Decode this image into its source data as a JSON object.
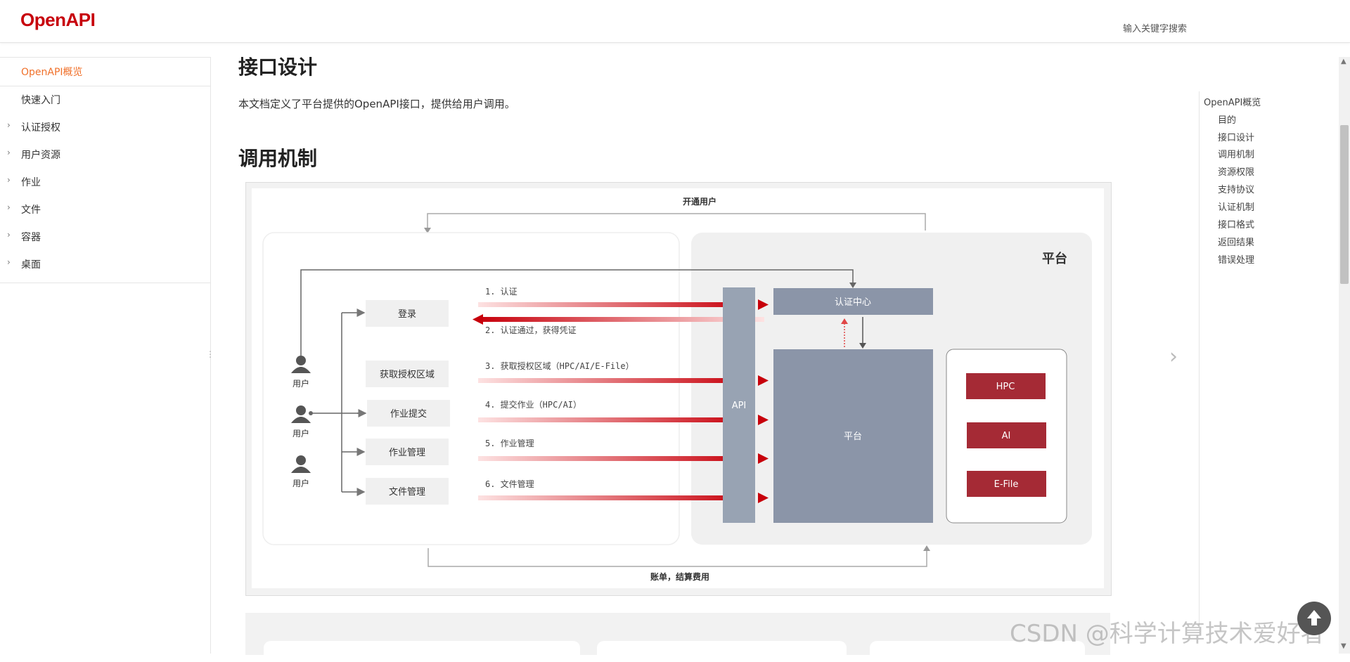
{
  "header": {
    "logo": "OpenAPI",
    "search_placeholder": "输入关键字搜索"
  },
  "sidebar": {
    "items": [
      {
        "label": "OpenAPI概览",
        "active": true,
        "expandable": false
      },
      {
        "label": "快速入门",
        "active": false,
        "expandable": false
      },
      {
        "label": "认证授权",
        "active": false,
        "expandable": true
      },
      {
        "label": "用户资源",
        "active": false,
        "expandable": true
      },
      {
        "label": "作业",
        "active": false,
        "expandable": true
      },
      {
        "label": "文件",
        "active": false,
        "expandable": true
      },
      {
        "label": "容器",
        "active": false,
        "expandable": true
      },
      {
        "label": "桌面",
        "active": false,
        "expandable": true
      }
    ]
  },
  "content": {
    "heading1": "接口设计",
    "intro": "本文档定义了平台提供的OpenAPI接口，提供给用户调用。",
    "heading2": "调用机制"
  },
  "diagram": {
    "top_label": "开通用户",
    "bottom_label": "账单，结算费用",
    "platform_title": "平台",
    "users": [
      "用户",
      "用户",
      "用户"
    ],
    "actions": [
      "登录",
      "获取授权区域",
      "作业提交",
      "作业管理",
      "文件管理"
    ],
    "steps": [
      "1. 认证",
      "2. 认证通过，获得凭证",
      "3. 获取授权区域（HPC/AI/E-File）",
      "4. 提交作业（HPC/AI）",
      "5. 作业管理",
      "6. 文件管理"
    ],
    "api_label": "API",
    "auth_center": "认证中心",
    "platform_box": "平台",
    "services": [
      "HPC",
      "AI",
      "E-File"
    ]
  },
  "toc": {
    "items": [
      "OpenAPI概览",
      "目的",
      "接口设计",
      "调用机制",
      "资源权限",
      "支持协议",
      "认证机制",
      "接口格式",
      "返回结果",
      "错误处理"
    ]
  },
  "watermark": "CSDN @科学计算技术爱好者",
  "colors": {
    "brand": "#c7000b",
    "active": "#f0712b",
    "diagram_red": "#c7000b",
    "api_bar": "#98a3b3",
    "platform_box": "#8b95a8",
    "service_red": "#a52a35"
  }
}
